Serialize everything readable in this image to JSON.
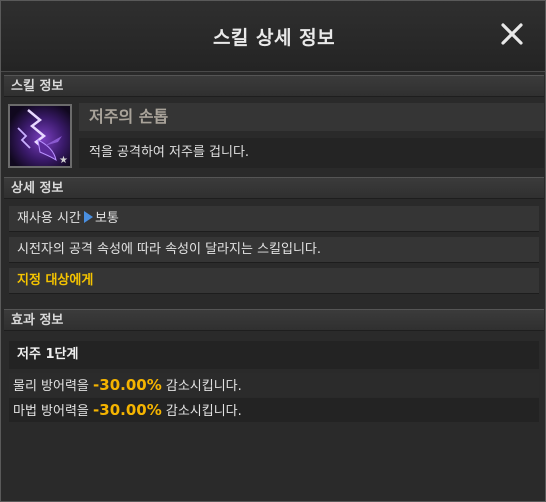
{
  "window": {
    "title": "스킬 상세 정보"
  },
  "sections": {
    "skill_info": "스킬 정보",
    "detail_info": "상세 정보",
    "effect_info": "효과 정보"
  },
  "skill": {
    "name": "저주의 손톱",
    "description": "적을 공격하여 저주를 겁니다.",
    "icon": "purple-lightning-claw-icon",
    "badge": "★"
  },
  "details": {
    "cooldown_label": "재사용 시간",
    "cooldown_value": "보통",
    "attribute_text": "시전자의 공격 속성에 따라 속성이 달라지는 스킬입니다.",
    "target_text": "지정 대상에게"
  },
  "effects": {
    "title": "저주 1단계",
    "rows": [
      {
        "prefix": "물리 방어력을 ",
        "value": "-30.00%",
        "suffix": " 감소시킵니다."
      },
      {
        "prefix": "마법 방어력을 ",
        "value": "-30.00%",
        "suffix": " 감소시킵니다."
      }
    ]
  },
  "colors": {
    "highlight": "#f5c400",
    "value": "#f5b400",
    "arrow": "#4a8fe0"
  }
}
